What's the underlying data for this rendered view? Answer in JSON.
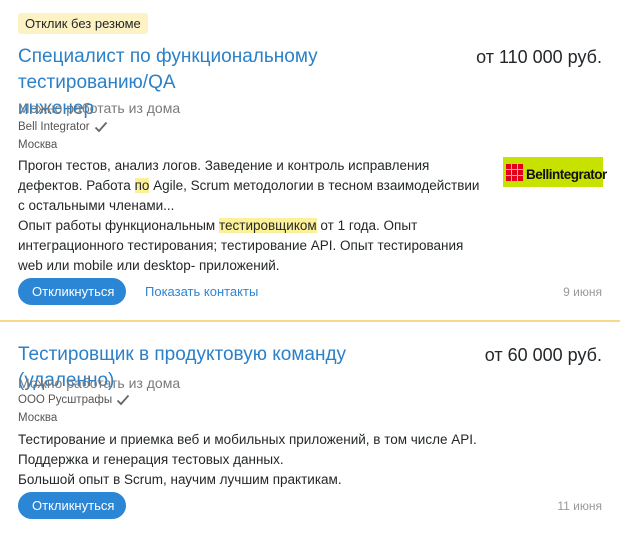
{
  "vacancies": [
    {
      "badge": "Отклик без резюме",
      "title_line1": "Специалист по функциональному тестированию/QA",
      "title_line2": "инженер",
      "salary": "от 110 000 руб.",
      "remote": "Можно работать из дома",
      "company": "Bell Integrator",
      "city": "Москва",
      "desc1_a": "Прогон тестов, анализ логов. Заведение и контроль исправления дефектов. Работа ",
      "desc1_hl": "по",
      "desc1_b": " Agile, Scrum методологии в тесном взаимодействии с остальными членами...",
      "desc2_a": "Опыт работы функциональным ",
      "desc2_hl": "тестировщиком",
      "desc2_b": " от 1 года. Опыт интеграционного тестирования; тестирование API. Опыт тестирования web или mobile или desktop- приложений.",
      "respond_label": "Откликнуться",
      "contacts_label": "Показать контакты",
      "date": "9 июня",
      "logo_text": "Bellintegrator"
    },
    {
      "title": "Тестировщик в продуктовую команду (удаленно)",
      "salary": "от 60 000 руб.",
      "remote": "Можно работать из дома",
      "company": "ООО Русштрафы",
      "city": "Москва",
      "desc1": "Тестирование и приемка веб и мобильных приложений, в том числе API. Поддержка и генерация тестовых данных.",
      "desc2": "Большой опыт в Scrum, научим лучшим практикам.",
      "respond_label": "Откликнуться",
      "date": "11 июня"
    }
  ],
  "colors": {
    "link": "#2b80c8",
    "button": "#2b86d6",
    "badge_bg": "#fdf2c4",
    "highlight": "#fcf199",
    "logo_bg": "#c8e200",
    "logo_red": "#e4001b",
    "divider": "#f7d98a"
  }
}
